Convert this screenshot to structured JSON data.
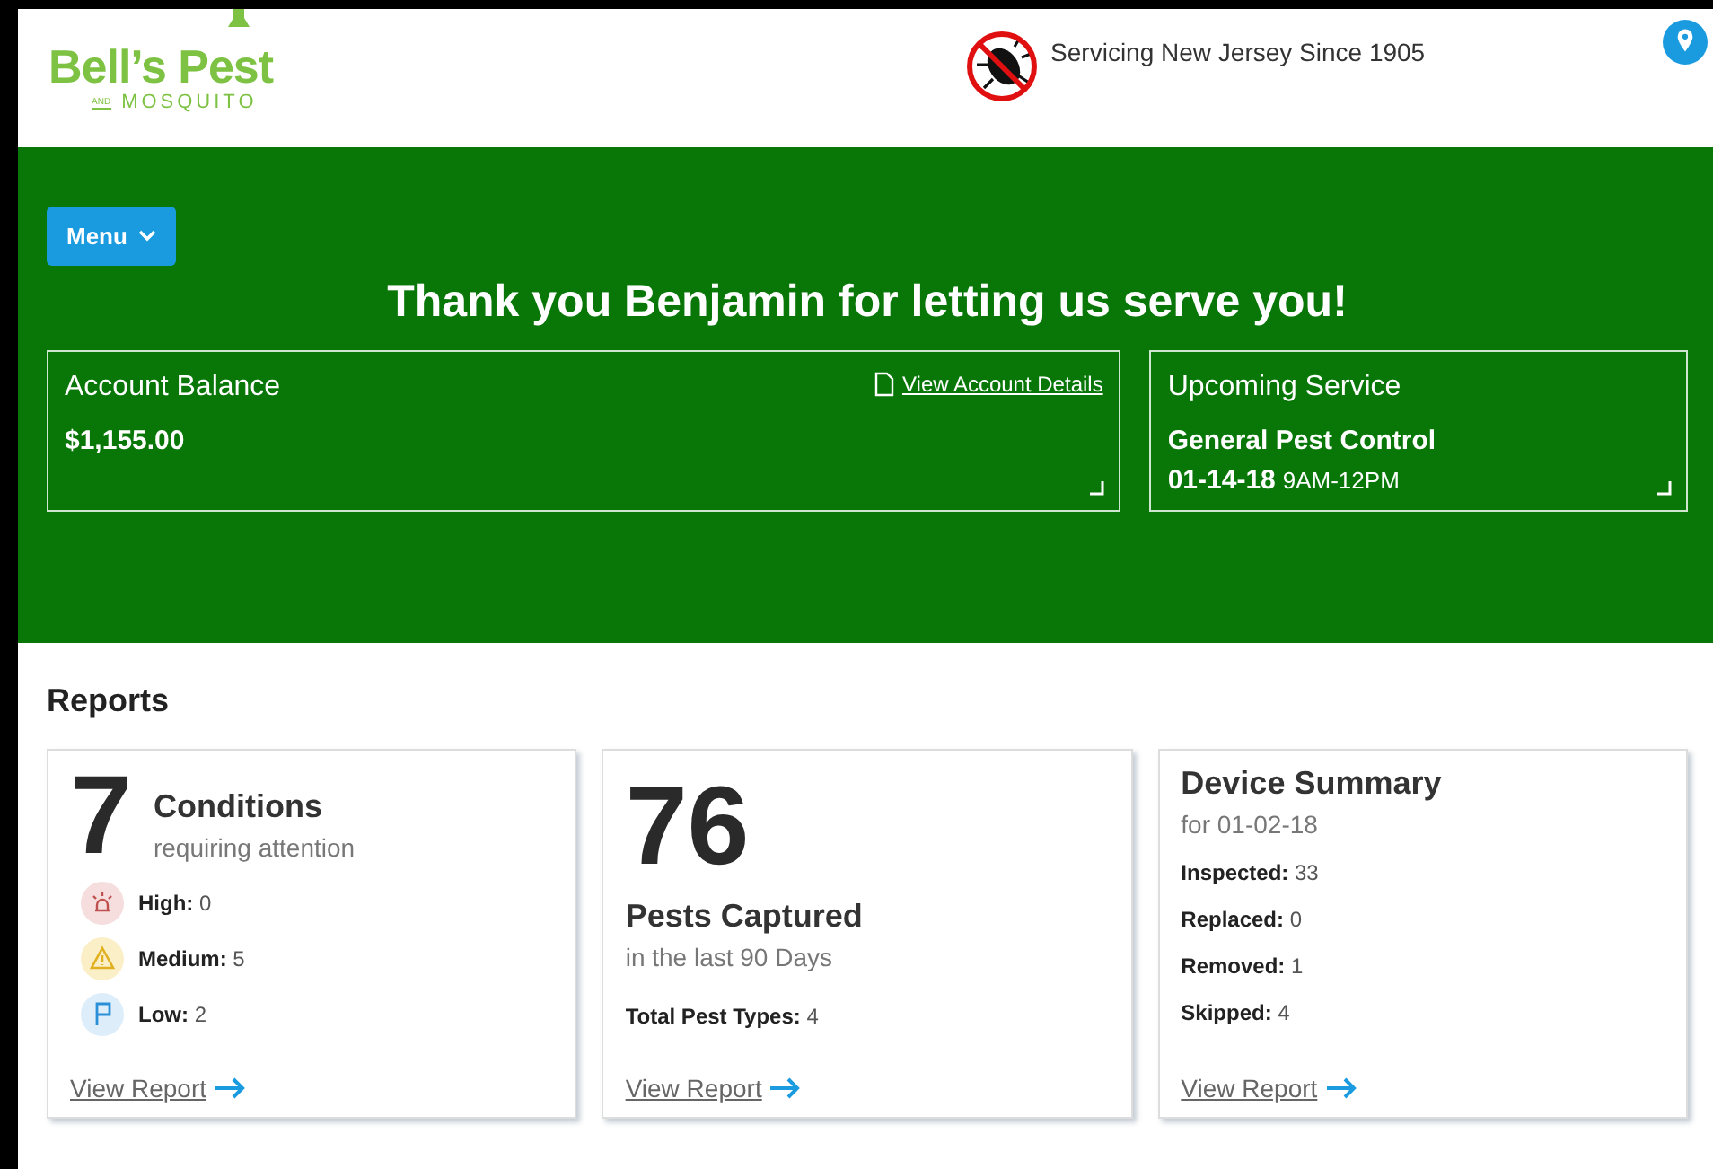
{
  "header": {
    "logo": {
      "name": "Bell’s Pest",
      "sub_and": "AND",
      "sub": "MOSQUITO"
    },
    "tagline": "Servicing New Jersey Since 1905"
  },
  "banner": {
    "menu": "Menu",
    "greeting": "Thank you Benjamin for letting us serve you!",
    "cards": [
      {
        "title": "Account Balance",
        "link": "View Account Details",
        "lines": [
          {
            "bold": "$1,155.00"
          }
        ]
      },
      {
        "title": "Upcoming Service",
        "lines": [
          {
            "bold": "General Pest Control"
          },
          {
            "bold": "01-14-18",
            "small": "9AM-12PM"
          }
        ]
      }
    ]
  },
  "reports": {
    "title": "Reports",
    "conditions": {
      "count": "7",
      "title": "Conditions",
      "subtitle": "requiring attention",
      "levels": [
        {
          "kind": "high",
          "label": "High:",
          "value": "0",
          "color": "#f6dede"
        },
        {
          "kind": "medium",
          "label": "Medium:",
          "value": "5",
          "color": "#fbefc7"
        },
        {
          "kind": "low",
          "label": "Low:",
          "value": "2",
          "color": "#ddeefa"
        }
      ],
      "link": "View Report"
    },
    "pests": {
      "count": "76",
      "title": "Pests Captured",
      "subtitle": "in the last 90 Days",
      "stats": [
        {
          "label": "Total Pest Types:",
          "value": "4"
        }
      ],
      "link": "View Report"
    },
    "devices": {
      "title": "Device Summary",
      "subtitle": "for 01-02-18",
      "stats": [
        {
          "label": "Inspected:",
          "value": "33"
        },
        {
          "label": "Replaced:",
          "value": "0"
        },
        {
          "label": "Removed:",
          "value": "1"
        },
        {
          "label": "Skipped:",
          "value": "4"
        }
      ],
      "link": "View Report"
    }
  }
}
